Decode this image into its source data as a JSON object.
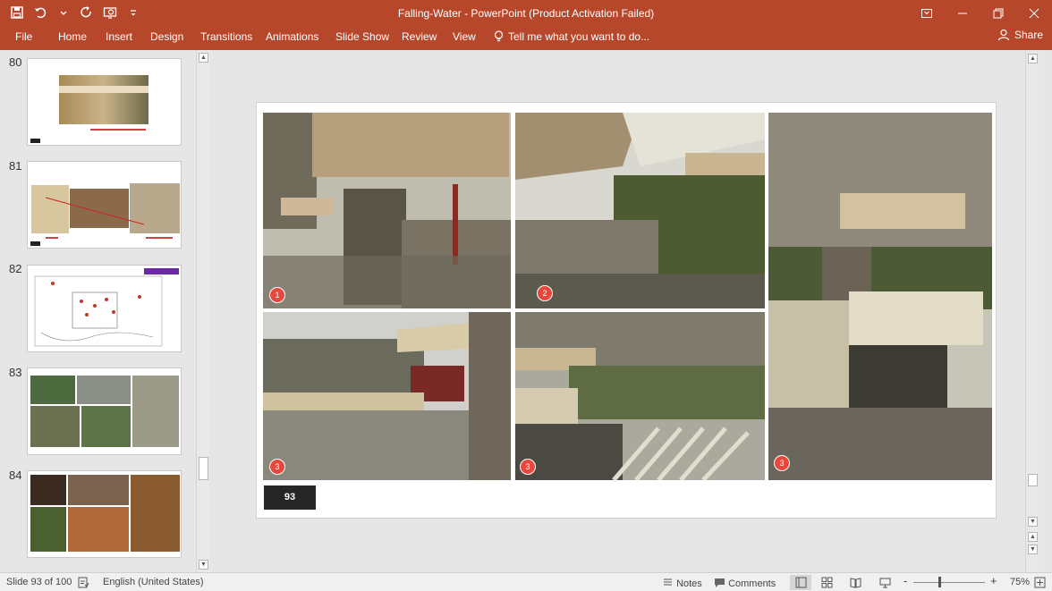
{
  "window": {
    "title": "Falling-Water - PowerPoint (Product Activation Failed)"
  },
  "ribbon": {
    "tabs": [
      "File",
      "Home",
      "Insert",
      "Design",
      "Transitions",
      "Animations",
      "Slide Show",
      "Review",
      "View"
    ],
    "tell_me": "Tell me what you want to do...",
    "share": "Share"
  },
  "thumbnails": {
    "items": [
      {
        "number": "80"
      },
      {
        "number": "81"
      },
      {
        "number": "82"
      },
      {
        "number": "83"
      },
      {
        "number": "84"
      }
    ]
  },
  "slide": {
    "number_label": "93",
    "badges": [
      "1",
      "2",
      "3",
      "3",
      "3"
    ]
  },
  "status": {
    "slide_info": "Slide 93 of 100",
    "language": "English (United States)",
    "notes": "Notes",
    "comments": "Comments",
    "zoom": "75%",
    "zoom_minus": "-",
    "zoom_plus": "+"
  },
  "colors": {
    "accent": "#b7472a",
    "badge": "#e8473b"
  }
}
